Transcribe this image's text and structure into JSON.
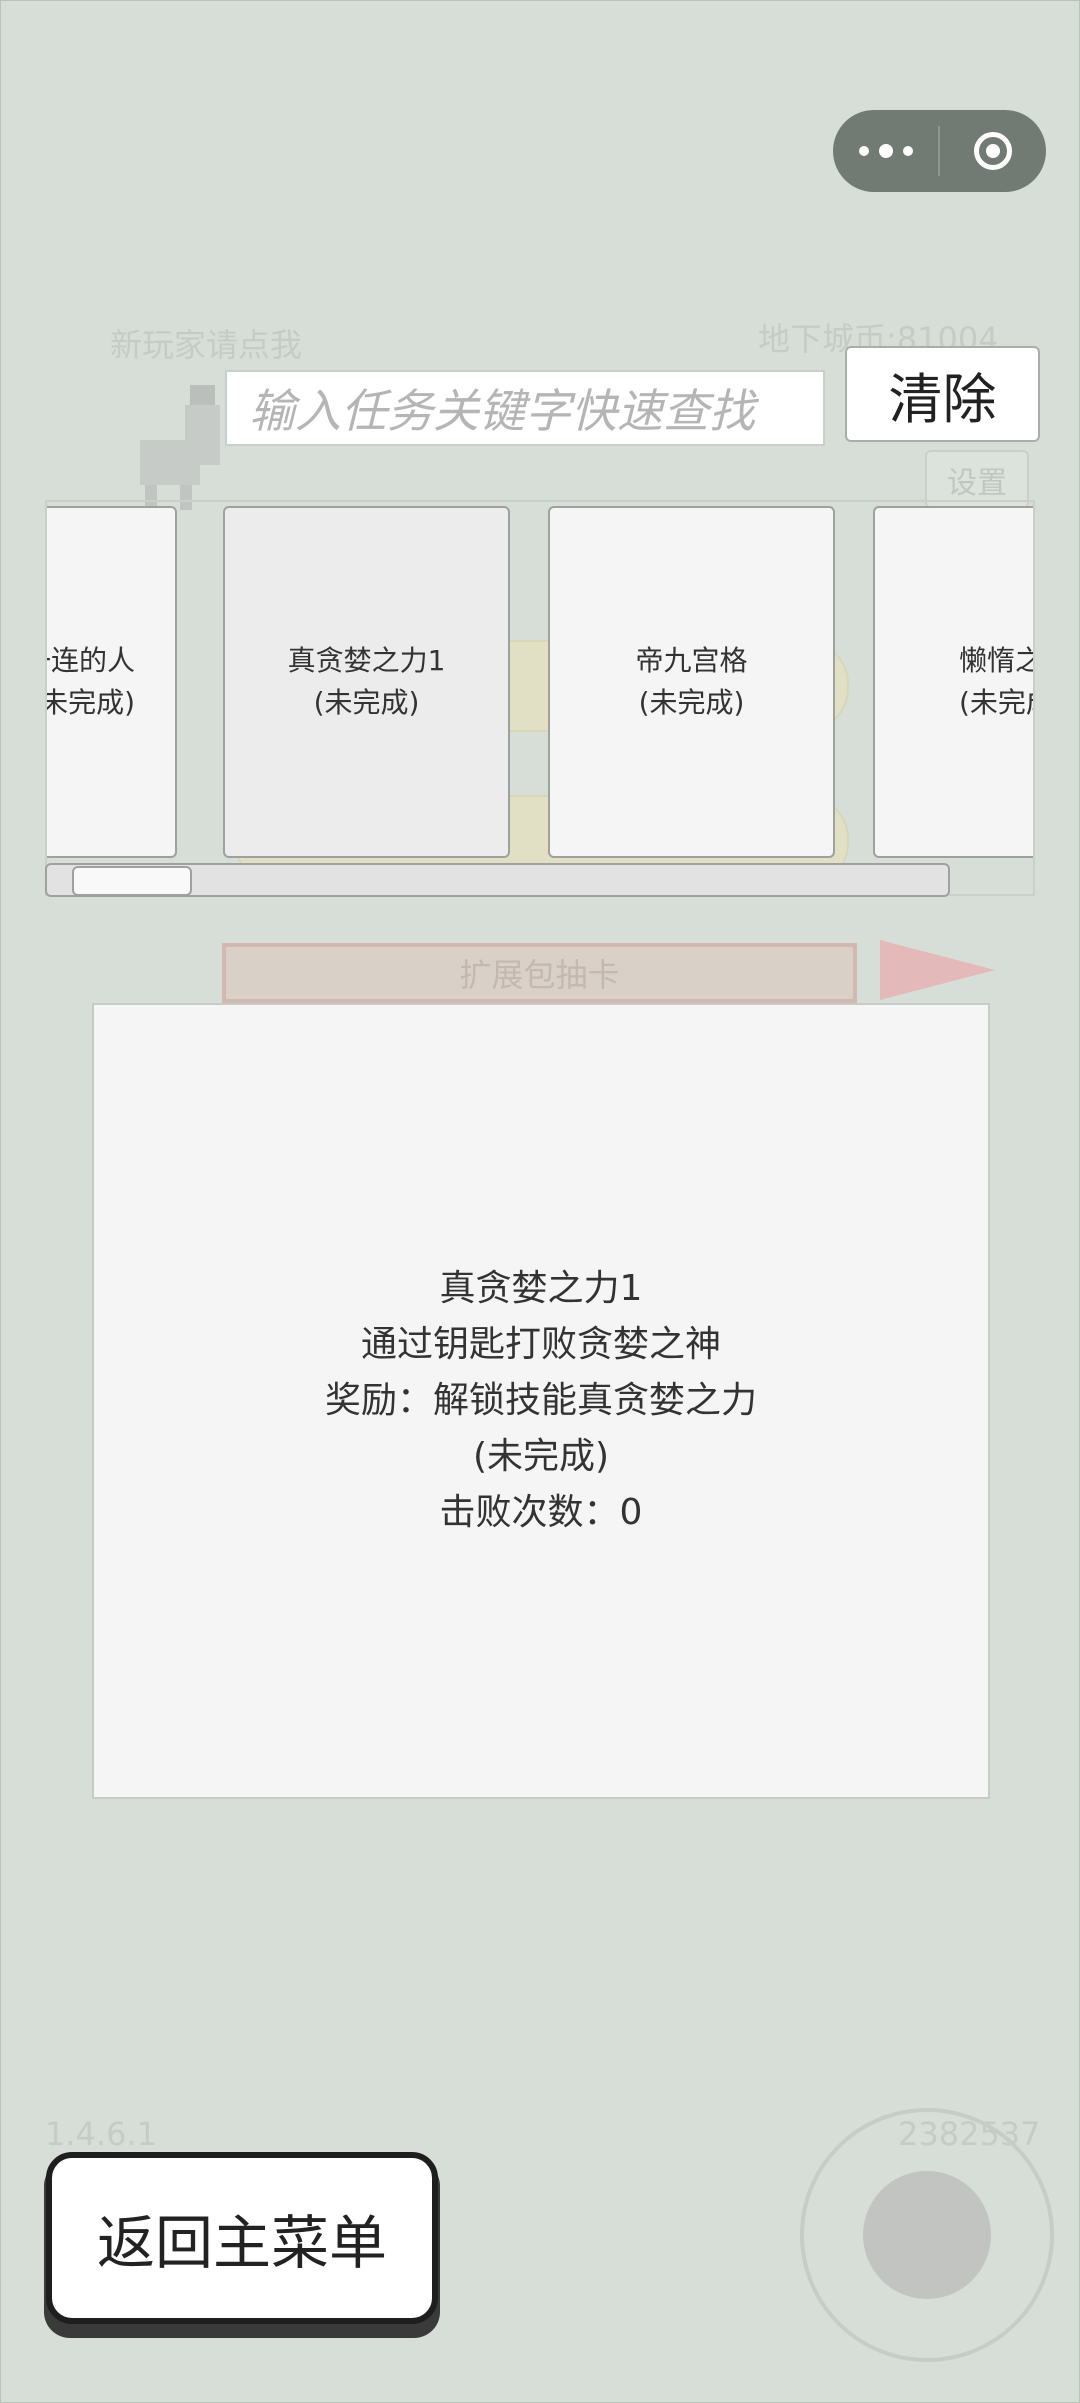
{
  "background": {
    "new_player_hint": "新玩家请点我",
    "dungeon_coins": "地下城币:81004",
    "settings_label": "设置",
    "expansion_draw": "扩展包抽卡",
    "version": "1.4.6.1",
    "player_id": "2382537"
  },
  "search": {
    "placeholder": "输入任务关键字快速查找",
    "clear_label": "清除"
  },
  "cards": [
    {
      "name": "一连的人",
      "status": "(未完成)"
    },
    {
      "name": "真贪婪之力1",
      "status": "(未完成)"
    },
    {
      "name": "帝九宫格",
      "status": "(未完成)"
    },
    {
      "name": "懒惰之力",
      "status": "(未完成)"
    }
  ],
  "detail": {
    "title": "真贪婪之力1",
    "description": "通过钥匙打败贪婪之神",
    "reward": "奖励：解锁技能真贪婪之力",
    "status": "(未完成)",
    "defeat_count": "击败次数：0"
  },
  "back_button": {
    "label": "返回主菜单"
  },
  "colors": {
    "background": "#d7ded7",
    "capsule": "#717b73",
    "card": "#f5f5f5"
  }
}
